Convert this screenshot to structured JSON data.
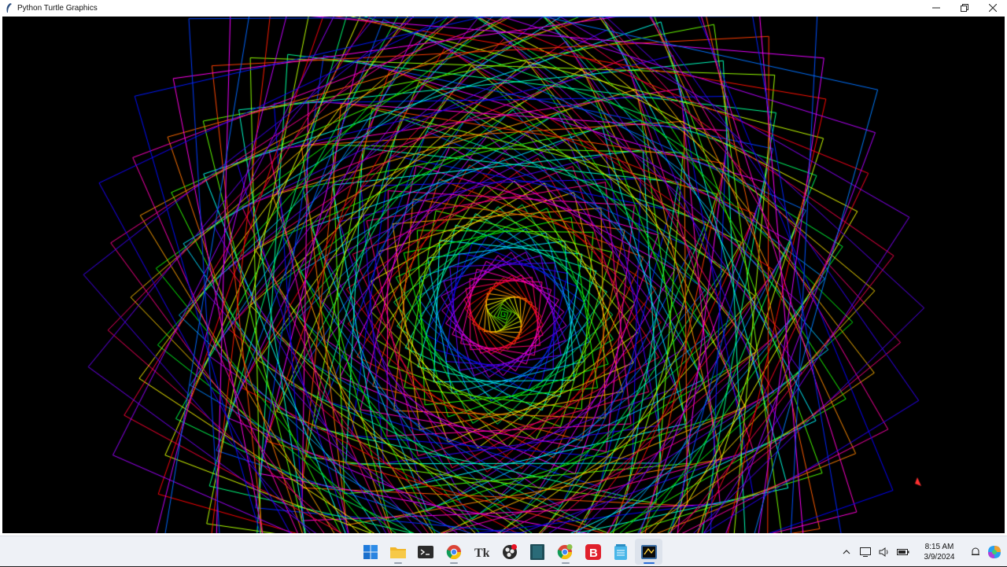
{
  "window": {
    "title": "Python Turtle Graphics",
    "controls": {
      "minimize": "—",
      "restore": "❐",
      "close": "✕"
    },
    "canvas": {
      "background": "#000000",
      "pattern": "rainbow-square-spiral",
      "turtle_color": "#ff3030"
    }
  },
  "taskbar": {
    "apps": [
      {
        "name": "start-button",
        "icon": "windows-logo-icon",
        "active": false
      },
      {
        "name": "file-explorer",
        "icon": "folder-icon",
        "active": false
      },
      {
        "name": "terminal",
        "icon": "terminal-icon",
        "active": false
      },
      {
        "name": "chrome",
        "icon": "chrome-icon",
        "active": false
      },
      {
        "name": "font-app",
        "icon": "font-icon",
        "active": false
      },
      {
        "name": "obs",
        "icon": "record-icon",
        "active": false
      },
      {
        "name": "book-app",
        "icon": "book-icon",
        "active": false
      },
      {
        "name": "chrome-profile",
        "icon": "chrome-icon",
        "active": false
      },
      {
        "name": "b-app",
        "icon": "b-icon",
        "active": false
      },
      {
        "name": "notepad",
        "icon": "notepad-icon",
        "active": false
      },
      {
        "name": "python-turtle",
        "icon": "python-turtle-icon",
        "active": true
      }
    ],
    "tray": {
      "time": "8:15 AM",
      "date": "3/9/2024"
    }
  }
}
